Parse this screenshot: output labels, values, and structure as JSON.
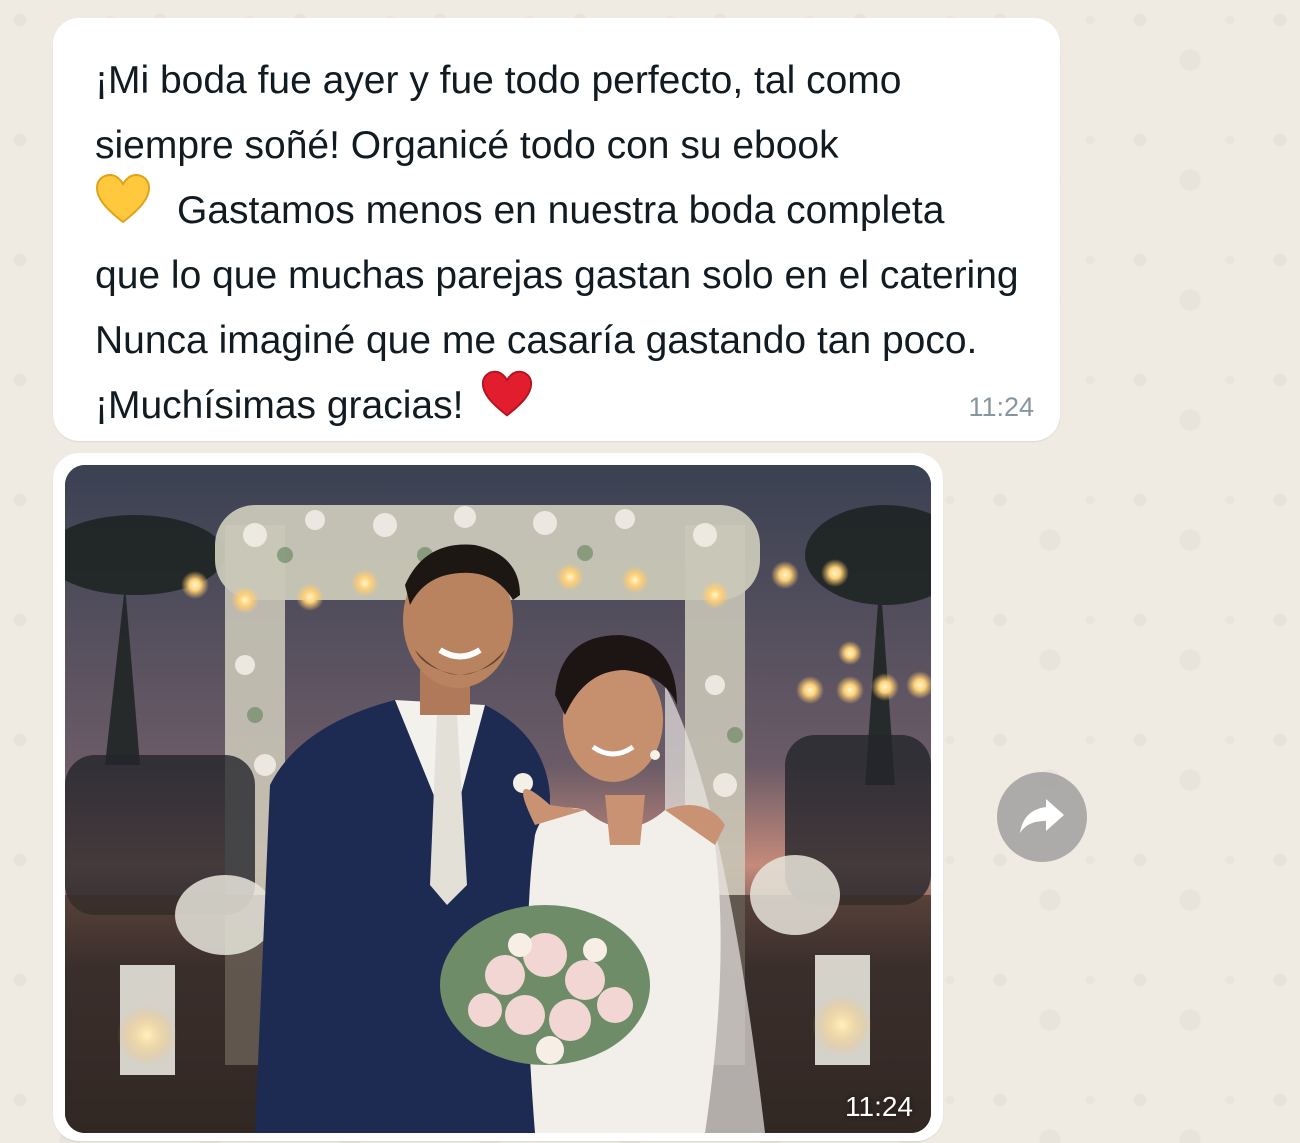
{
  "message": {
    "lines": [
      "¡Mi boda fue ayer y fue todo perfecto, tal como",
      "siempre soñé! Organicé todo con su ebook",
      "Gastamos menos en nuestra boda completa",
      "que lo que muchas parejas gastan solo en el catering",
      "Nunca imaginé que me casaría gastando tan poco.",
      "¡Muchísimas gracias!"
    ],
    "time": "11:24"
  },
  "image_message": {
    "time": "11:24"
  },
  "icons": {
    "yellow_heart": "yellow-heart-icon",
    "red_heart": "red-heart-icon",
    "forward": "forward-icon"
  },
  "colors": {
    "chat_background": "#efeae2",
    "bubble": "#ffffff",
    "text": "#111b21",
    "timestamp": "#8696a0",
    "yellow_heart": "#ffc83d",
    "red_heart": "#e11d2e",
    "forward_button": "#a0a0a0"
  }
}
